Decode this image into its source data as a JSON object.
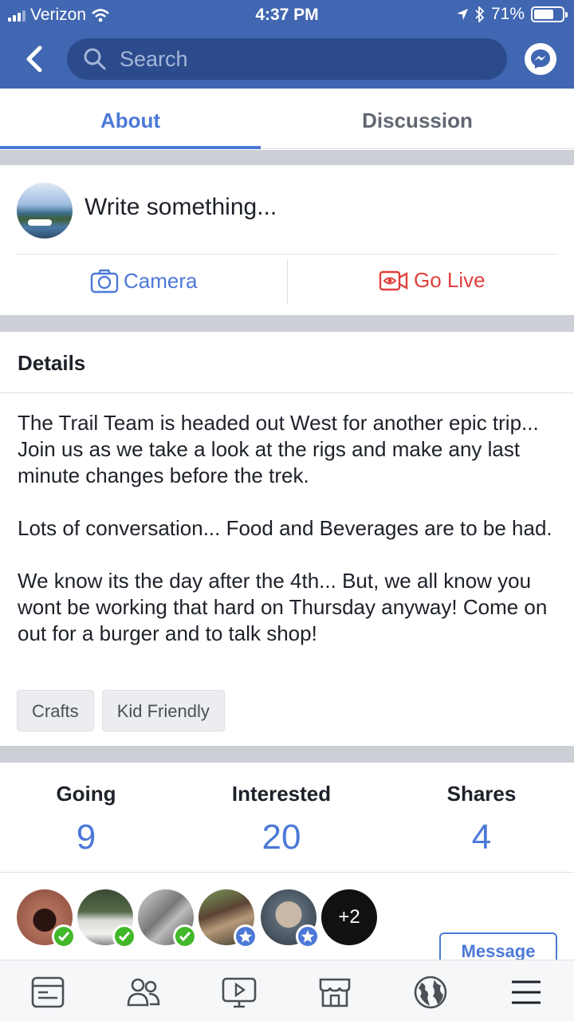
{
  "status_bar": {
    "carrier": "Verizon",
    "time": "4:37 PM",
    "battery": "71%",
    "battery_level": 0.71
  },
  "header": {
    "search_placeholder": "Search",
    "icons": [
      "back-chevron-icon",
      "search-icon",
      "messenger-icon"
    ]
  },
  "tabs": [
    {
      "label": "About",
      "active": true
    },
    {
      "label": "Discussion",
      "active": false
    }
  ],
  "composer": {
    "prompt": "Write something...",
    "camera_label": "Camera",
    "live_label": "Go Live"
  },
  "details": {
    "heading": "Details",
    "paragraphs": [
      "The Trail Team is headed out West for another epic trip...  Join us as we take a look at the rigs and make any last minute changes before the trek.",
      "Lots of conversation...  Food and Beverages are to be had.",
      "We know its the day after the 4th...  But, we all know you wont be working that hard on Thursday anyway!  Come on out for a burger and to talk shop!"
    ],
    "tags": [
      "Crafts",
      "Kid Friendly"
    ]
  },
  "stats": [
    {
      "label": "Going",
      "value": "9"
    },
    {
      "label": "Interested",
      "value": "20"
    },
    {
      "label": "Shares",
      "value": "4"
    }
  ],
  "guests": {
    "avatars": [
      {
        "status": "going"
      },
      {
        "status": "going"
      },
      {
        "status": "going"
      },
      {
        "status": "interested"
      },
      {
        "status": "interested"
      }
    ],
    "more_label": "+2",
    "message_label": "Message"
  },
  "bottom_nav": [
    "news-feed-icon",
    "friends-icon",
    "watch-icon",
    "marketplace-icon",
    "globe-icon",
    "menu-icon"
  ],
  "colors": {
    "brand": "#4167b2",
    "accent": "#4c79d8",
    "live": "#e0403e",
    "going_badge": "#42b72a"
  }
}
